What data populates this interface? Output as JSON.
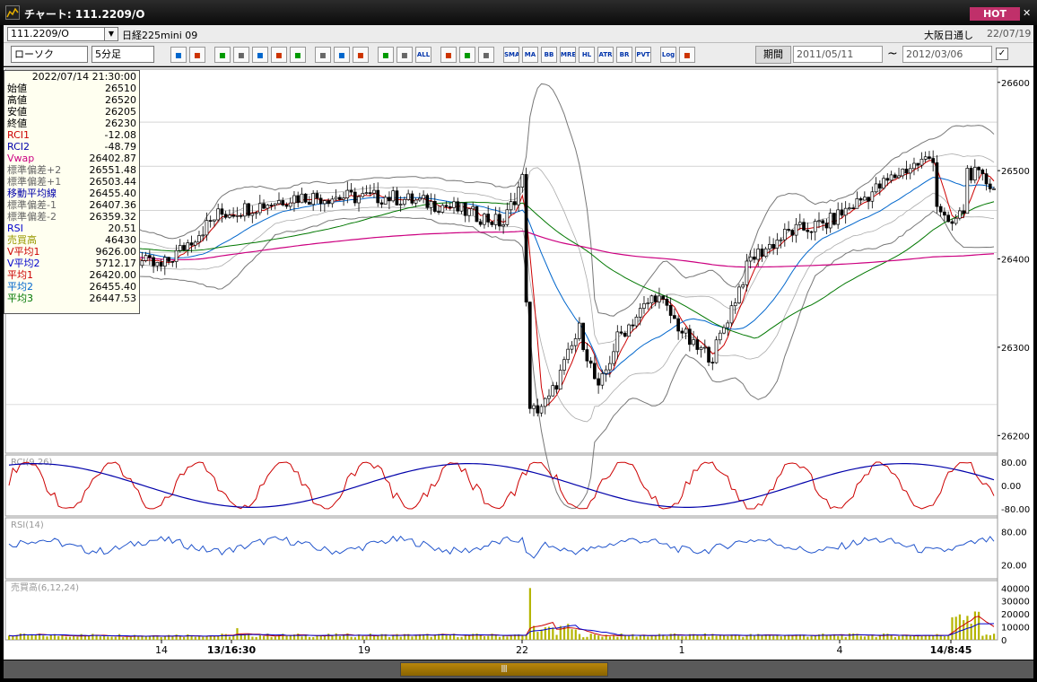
{
  "window": {
    "title": "チャート: 111.2209/O",
    "hot_label": "HOT",
    "close_label": "✕"
  },
  "toolbar1": {
    "symbol": "111.2209/O",
    "instrument": "日経225mini 09",
    "market": "大阪日通し",
    "date": "22/07/19"
  },
  "toolbar2": {
    "chart_type": "ローソク",
    "interval": "5分足",
    "tools": [
      "zoom-icon",
      "crosshair-icon",
      "candle-icon",
      "trend-icon",
      "bar-icon",
      "split-icon",
      "delete-icon",
      "pen-icon",
      "cursor-icon",
      "redo-icon",
      "ma-add-icon",
      "ma-remove-icon",
      "ALL",
      "gear-icon",
      "wrench-icon",
      "palette-icon",
      "SMA",
      "MA",
      "BB",
      "MRE",
      "HL",
      "ATR",
      "BR",
      "PVT",
      "Log",
      "export-icon"
    ],
    "period_label": "期間",
    "start_date": "2011/05/11",
    "end_date": "2012/03/06",
    "tilde": "~"
  },
  "info_panel": {
    "datetime": "2022/07/14  21:30:00",
    "rows": [
      {
        "label": "始値",
        "value": "26510",
        "color": "#000000"
      },
      {
        "label": "高値",
        "value": "26520",
        "color": "#000000"
      },
      {
        "label": "安値",
        "value": "26205",
        "color": "#000000"
      },
      {
        "label": "終値",
        "value": "26230",
        "color": "#000000"
      },
      {
        "label": "RCI1",
        "value": "-12.08",
        "color": "#cc0000"
      },
      {
        "label": "RCI2",
        "value": "-48.79",
        "color": "#0000aa"
      },
      {
        "label": "Vwap",
        "value": "26402.87",
        "color": "#cc0080"
      },
      {
        "label": "標準偏差+2",
        "value": "26551.48",
        "color": "#666666"
      },
      {
        "label": "標準偏差+1",
        "value": "26503.44",
        "color": "#666666"
      },
      {
        "label": "移動平均線",
        "value": "26455.40",
        "color": "#0000aa"
      },
      {
        "label": "標準偏差-1",
        "value": "26407.36",
        "color": "#666666"
      },
      {
        "label": "標準偏差-2",
        "value": "26359.32",
        "color": "#666666"
      },
      {
        "label": "RSI",
        "value": "20.51",
        "color": "#0000cc"
      },
      {
        "label": "売買高",
        "value": "46430",
        "color": "#999900"
      },
      {
        "label": "V平均1",
        "value": "9626.00",
        "color": "#cc0000"
      },
      {
        "label": "V平均2",
        "value": "5712.17",
        "color": "#0000cc"
      },
      {
        "label": "平均1",
        "value": "26420.00",
        "color": "#cc0000"
      },
      {
        "label": "平均2",
        "value": "26455.40",
        "color": "#0066cc"
      },
      {
        "label": "平均3",
        "value": "26447.53",
        "color": "#007700"
      }
    ]
  },
  "chart": {
    "price_ticks": [
      "26600",
      "26500",
      "26400",
      "26300",
      "26200"
    ],
    "rci_label": "RCI(9,26)",
    "rci_ticks": [
      "80.00",
      "0.00",
      "-80.00"
    ],
    "rsi_label": "RSI(14)",
    "rsi_ticks": [
      "80.00",
      "20.00"
    ],
    "vol_label": "売買高(6,12,24)",
    "vol_ticks": [
      "40000",
      "30000",
      "20000",
      "10000",
      "0"
    ],
    "x_ticks": [
      "14",
      "13/16:30",
      "19",
      "22",
      "1",
      "4",
      "14/8:45"
    ],
    "x_ticks_bold": [
      false,
      true,
      false,
      false,
      false,
      false,
      true
    ],
    "price_range": [
      26180,
      26615
    ],
    "vol_max": 43000
  },
  "scrollbar": {
    "thumb_label": "Ⅲ"
  },
  "colors": {
    "sma": "#0066cc",
    "ema": "#cc0000",
    "long_ma": "#007700",
    "vwap": "#cc0080",
    "vol_bar": "#b5b500"
  }
}
